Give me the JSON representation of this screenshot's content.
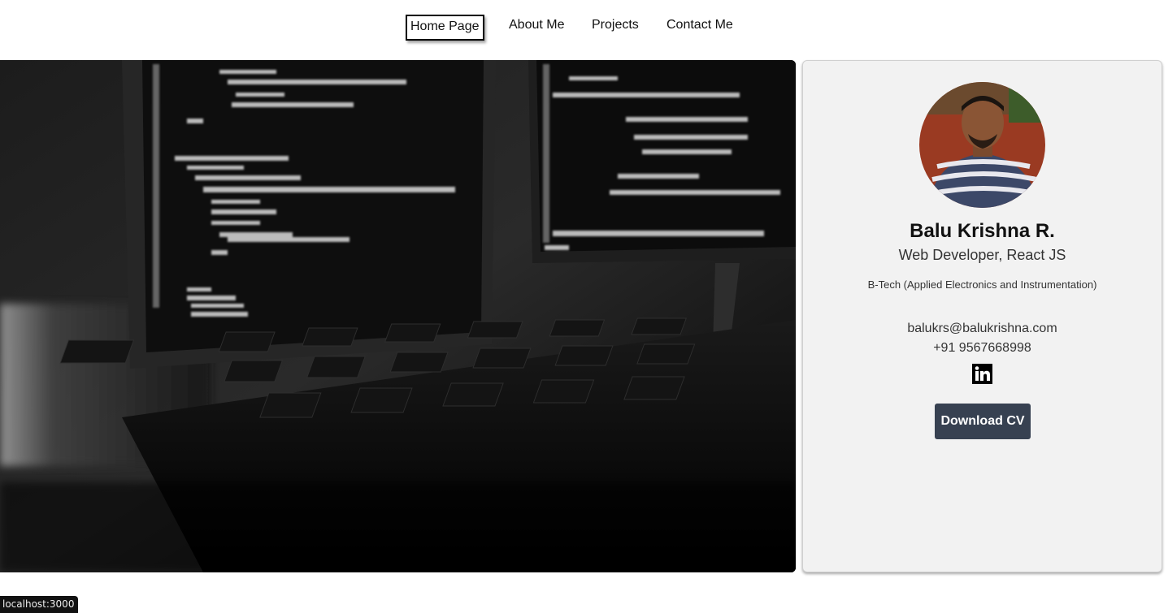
{
  "nav": {
    "items": [
      {
        "label": "Home Page",
        "active": true
      },
      {
        "label": "About Me",
        "active": false
      },
      {
        "label": "Projects",
        "active": false
      },
      {
        "label": "Contact Me",
        "active": false
      }
    ]
  },
  "hero": {
    "image_description": "Black and white photo of computer monitors showing code and a keyboard"
  },
  "profile": {
    "name": "Balu Krishna R.",
    "role": "Web Developer, React JS",
    "degree": "B-Tech (Applied Electronics and Instrumentation)",
    "email": "balukrs@balukrishna.com",
    "phone": "+91 9567668998",
    "social_icon": "linkedin-icon",
    "cv_button": "Download CV"
  },
  "status_bar": {
    "url": "localhost:3000"
  },
  "colors": {
    "button_bg": "#374151",
    "card_bg": "#f2f2f2"
  }
}
